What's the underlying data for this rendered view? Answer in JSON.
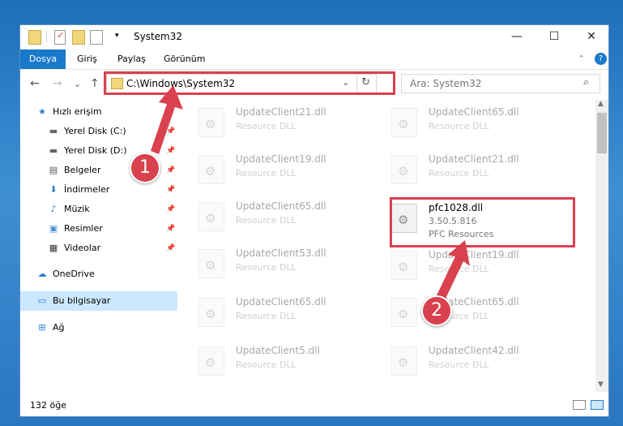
{
  "window": {
    "title": "System32",
    "minimize": "—",
    "maximize": "☐",
    "close": "✕"
  },
  "ribbon": {
    "tabs": [
      "Dosya",
      "Giriş",
      "Paylaş",
      "Görünüm"
    ],
    "collapse": "⌃",
    "help": "?"
  },
  "navigation": {
    "back": "←",
    "forward": "→",
    "recent": "⌄",
    "up": "↑",
    "address": "C:\\Windows\\System32",
    "dropdown": "⌄",
    "refresh": "↻"
  },
  "search": {
    "placeholder": "Ara: System32",
    "icon": "⌕"
  },
  "sidebar": {
    "items": [
      {
        "label": "Hızlı erişim",
        "icon": "star-icon",
        "glyph": "★"
      },
      {
        "label": "Yerel Disk (C:)",
        "icon": "drive-icon",
        "glyph": "▬"
      },
      {
        "label": "Yerel Disk (D:)",
        "icon": "drive-icon",
        "glyph": "▬"
      },
      {
        "label": "Belgeler",
        "icon": "documents-icon",
        "glyph": "▤"
      },
      {
        "label": "İndirmeler",
        "icon": "downloads-icon",
        "glyph": "⬇"
      },
      {
        "label": "Müzik",
        "icon": "music-icon",
        "glyph": "♪"
      },
      {
        "label": "Resimler",
        "icon": "pictures-icon",
        "glyph": "▣"
      },
      {
        "label": "Videolar",
        "icon": "videos-icon",
        "glyph": "▦"
      },
      {
        "label": "OneDrive",
        "icon": "cloud-icon",
        "glyph": "☁"
      },
      {
        "label": "Bu bilgisayar",
        "icon": "computer-icon",
        "glyph": "▭"
      },
      {
        "label": "Ağ",
        "icon": "network-icon",
        "glyph": "⊞"
      }
    ]
  },
  "files": {
    "left": [
      {
        "name": "UpdateClient21.dll",
        "desc": "Resource DLL"
      },
      {
        "name": "UpdateClient19.dll",
        "desc": "Resource DLL"
      },
      {
        "name": "UpdateClient65.dll",
        "desc": "Resource DLL"
      },
      {
        "name": "UpdateClient53.dll",
        "desc": "Resource DLL"
      },
      {
        "name": "UpdateClient65.dll",
        "desc": "Resource DLL"
      },
      {
        "name": "UpdateClient5.dll",
        "desc": "Resource DLL"
      }
    ],
    "right": [
      {
        "name": "UpdateClient65.dll",
        "desc": "Resource DLL"
      },
      {
        "name": "UpdateClient21.dll",
        "desc": "Resource DLL"
      },
      {
        "name": "pfc1028.dll",
        "version": "3.50.5.816",
        "desc": "PFC Resources"
      },
      {
        "name": "UpdateClient19.dll",
        "desc": "Resource DLL"
      },
      {
        "name": "UpdateClient65.dll",
        "desc": "Resource DLL"
      },
      {
        "name": "UpdateClient42.dll",
        "desc": "Resource DLL"
      }
    ]
  },
  "status": {
    "count": "132 öğe"
  },
  "callouts": [
    "1",
    "2"
  ],
  "colors": {
    "accent": "#1979ca",
    "highlight": "#d9414e",
    "selected": "#cce8ff"
  }
}
